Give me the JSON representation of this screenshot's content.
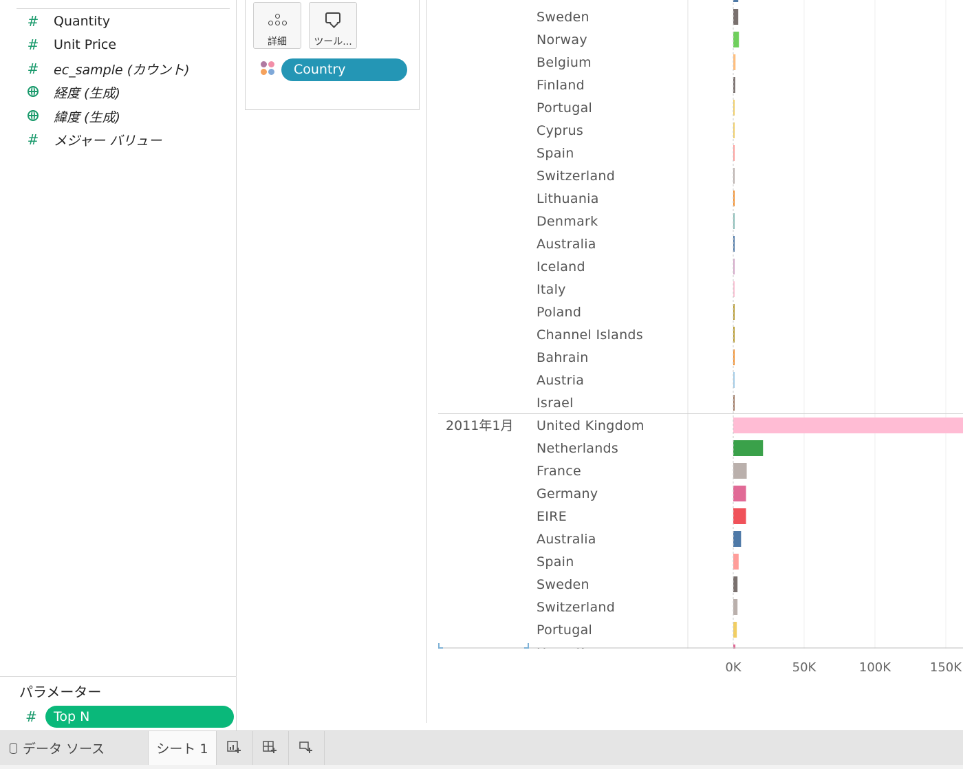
{
  "data_pane": {
    "fields": [
      {
        "icon": "hash-measure-icon",
        "name": "Quantity",
        "italic": false
      },
      {
        "icon": "hash-measure-icon",
        "name": "Unit Price",
        "italic": false
      },
      {
        "icon": "hash-measure-icon",
        "name": "ec_sample (カウント)",
        "italic": true
      },
      {
        "icon": "globe-geo-icon",
        "name": "経度 (生成)",
        "italic": true
      },
      {
        "icon": "globe-geo-icon",
        "name": "緯度 (生成)",
        "italic": true
      },
      {
        "icon": "hash-measure-icon",
        "name": "メジャー バリュー",
        "italic": true
      }
    ],
    "parameters_title": "パラメーター",
    "parameter": {
      "name": "Top N",
      "icon": "hash-measure-icon"
    }
  },
  "marks_card": {
    "detail_label": "詳細",
    "tooltip_label": "ツール...",
    "color_field": "Country",
    "pill_color": "#2496b5"
  },
  "chart_data": {
    "type": "bar",
    "orientation": "horizontal",
    "xlim": [
      0,
      165000
    ],
    "xticks": [
      {
        "value": 0,
        "label": "0K"
      },
      {
        "value": 50000,
        "label": "50K"
      },
      {
        "value": 100000,
        "label": "100K"
      },
      {
        "value": 150000,
        "label": "150K"
      }
    ],
    "panes": [
      {
        "period": "",
        "rows": [
          {
            "country": "",
            "value": 3500,
            "color": "#4e79a7"
          },
          {
            "country": "Sweden",
            "value": 3500,
            "color": "#79706e"
          },
          {
            "country": "Norway",
            "value": 4000,
            "color": "#6fcf5c"
          },
          {
            "country": "Belgium",
            "value": 1600,
            "color": "#ffbe7d"
          },
          {
            "country": "Finland",
            "value": 1400,
            "color": "#79706e"
          },
          {
            "country": "Portugal",
            "value": 900,
            "color": "#f1ce63"
          },
          {
            "country": "Cyprus",
            "value": 900,
            "color": "#f1ce63"
          },
          {
            "country": "Spain",
            "value": 900,
            "color": "#ff9d9a"
          },
          {
            "country": "Switzerland",
            "value": 700,
            "color": "#bab0ac"
          },
          {
            "country": "Lithuania",
            "value": 700,
            "color": "#f28e2b"
          },
          {
            "country": "Denmark",
            "value": 700,
            "color": "#86bcb6"
          },
          {
            "country": "Australia",
            "value": 700,
            "color": "#4e79a7"
          },
          {
            "country": "Iceland",
            "value": 600,
            "color": "#d4a6c8"
          },
          {
            "country": "Italy",
            "value": 600,
            "color": "#fabfd2"
          },
          {
            "country": "Poland",
            "value": 600,
            "color": "#b6992d"
          },
          {
            "country": "Channel Islands",
            "value": 600,
            "color": "#b6992d"
          },
          {
            "country": "Bahrain",
            "value": 600,
            "color": "#f28e2b"
          },
          {
            "country": "Austria",
            "value": 500,
            "color": "#a0cbe8"
          },
          {
            "country": "Israel",
            "value": 500,
            "color": "#9d7660"
          }
        ]
      },
      {
        "period": "2011年1月",
        "rows": [
          {
            "country": "United Kingdom",
            "value": 165000,
            "color": "#ffbcd4"
          },
          {
            "country": "Netherlands",
            "value": 21000,
            "color": "#3aa14a"
          },
          {
            "country": "France",
            "value": 9500,
            "color": "#bab0ac"
          },
          {
            "country": "Germany",
            "value": 9000,
            "color": "#e16a96"
          },
          {
            "country": "EIRE",
            "value": 9000,
            "color": "#f0525a"
          },
          {
            "country": "Australia",
            "value": 5500,
            "color": "#4e79a7"
          },
          {
            "country": "Spain",
            "value": 3800,
            "color": "#ff9d9a"
          },
          {
            "country": "Sweden",
            "value": 3000,
            "color": "#79706e"
          },
          {
            "country": "Switzerland",
            "value": 3000,
            "color": "#bab0ac"
          },
          {
            "country": "Portugal",
            "value": 2500,
            "color": "#f1ce63"
          },
          {
            "country": "Hong Kong",
            "value": 1500,
            "color": "#e16a96"
          }
        ]
      }
    ]
  },
  "tabs": {
    "data_source": "データ ソース",
    "sheet1": "シート 1",
    "new_sheet_icon": "new-worksheet-icon",
    "new_dashboard_icon": "new-dashboard-icon",
    "new_story_icon": "new-story-icon"
  }
}
